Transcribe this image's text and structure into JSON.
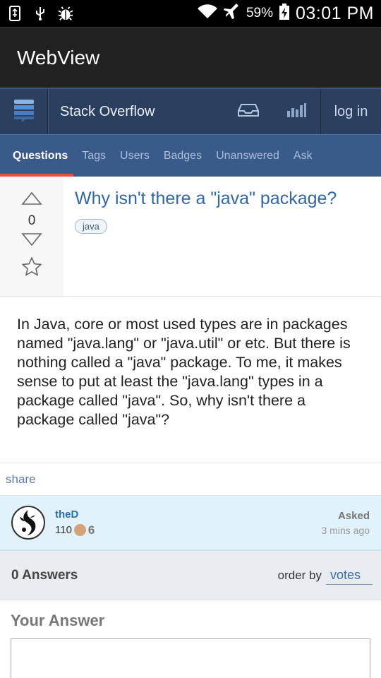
{
  "status_bar": {
    "battery_percent": "59%",
    "time": "03:01 PM",
    "icons": [
      "usb-icon",
      "usb-debug-icon",
      "bug-icon",
      "wifi-icon",
      "airplane-icon",
      "battery-charging-icon"
    ]
  },
  "app_bar": {
    "title": "WebView"
  },
  "so_header": {
    "site_name": "Stack Overflow",
    "login_label": "log in"
  },
  "tabs": [
    {
      "label": "Questions",
      "active": true
    },
    {
      "label": "Tags"
    },
    {
      "label": "Users"
    },
    {
      "label": "Badges"
    },
    {
      "label": "Unanswered"
    },
    {
      "label": "Ask"
    }
  ],
  "question": {
    "title": "Why isn't there a \"java\" package?",
    "vote_count": "0",
    "tag": "java",
    "body": "In Java, core or most used types are in packages named \"java.lang\" or \"java.util\" or etc. But there is nothing called a \"java\" package. To me, it makes sense to put at least the \"java.lang\" types in a package called \"java\". So, why isn't there a package called \"java\"?",
    "share_label": "share"
  },
  "user": {
    "name": "theD",
    "reputation": "110",
    "bronze_badges": "6",
    "asked_label": "Asked",
    "asked_time": "3 mins ago"
  },
  "answers": {
    "count_label": "0 Answers",
    "order_label": "order by",
    "order_value": "votes"
  },
  "your_answer": {
    "title": "Your Answer"
  },
  "colors": {
    "so_header": "#2b3f5f",
    "tabs_bg": "#3a5a8a",
    "active_tab_underline": "#e2513b",
    "link_blue": "#3366a3",
    "user_card_bg": "#e1f2fa"
  }
}
